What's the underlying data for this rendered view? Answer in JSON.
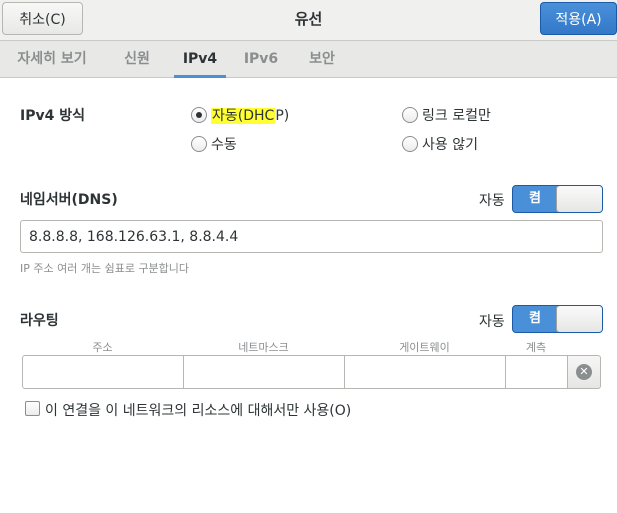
{
  "header": {
    "cancel_label": "취소(C)",
    "title": "유선",
    "apply_label": "적용(A)",
    "accent_color": "#4a90d9"
  },
  "tabs": [
    {
      "label": "자세히 보기",
      "active": false
    },
    {
      "label": "신원",
      "active": false
    },
    {
      "label": "IPv4",
      "active": true
    },
    {
      "label": "IPv6",
      "active": false
    },
    {
      "label": "보안",
      "active": false
    }
  ],
  "ipv4_method": {
    "label": "IPv4 방식",
    "options": [
      {
        "label_prefix": "자동",
        "label_hl": "(DHC",
        "label_suffix": "P)",
        "checked": true
      },
      {
        "label": "링크 로컬만",
        "checked": false
      },
      {
        "label": "수동",
        "checked": false
      },
      {
        "label": "사용 않기",
        "checked": false
      }
    ]
  },
  "dns": {
    "label": "네임서버(DNS)",
    "auto_label": "자동",
    "switch_on_label": "켬",
    "value": "8.8.8.8, 168.126.63.1, 8.8.4.4",
    "hint": "IP 주소 여러 개는 쉼표로 구분합니다"
  },
  "routing": {
    "label": "라우팅",
    "auto_label": "자동",
    "switch_on_label": "켬",
    "columns": [
      "주소",
      "네트마스크",
      "게이트웨이",
      "계측"
    ],
    "only_local_label": "이 연결을 이 네트워크의 리소스에 대해서만 사용(O)",
    "only_local_checked": false
  }
}
